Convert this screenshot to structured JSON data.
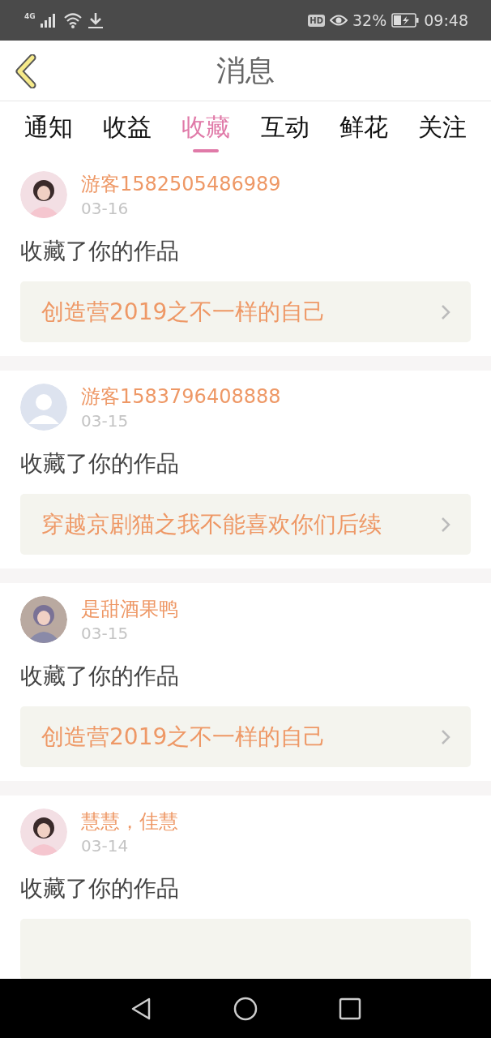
{
  "status_bar": {
    "network": "4G",
    "hd": "HD",
    "battery": "32%",
    "time": "09:48"
  },
  "header": {
    "title": "消息"
  },
  "tabs": [
    {
      "label": "通知",
      "selected": false
    },
    {
      "label": "收益",
      "selected": false
    },
    {
      "label": "收藏",
      "selected": true
    },
    {
      "label": "互动",
      "selected": false
    },
    {
      "label": "鲜花",
      "selected": false
    },
    {
      "label": "关注",
      "selected": false
    }
  ],
  "messages": [
    {
      "kind": "picture",
      "user": "游客1582505486989",
      "date": "03-16",
      "action": "收藏了你的作品",
      "work": "创造营2019之不一样的自己"
    },
    {
      "kind": "default",
      "user": "游客1583796408888",
      "date": "03-15",
      "action": "收藏了你的作品",
      "work": "穿越京剧猫之我不能喜欢你们后续"
    },
    {
      "kind": "picture",
      "user": "是甜酒果鸭",
      "date": "03-15",
      "action": "收藏了你的作品",
      "work": "创造营2019之不一样的自己"
    },
    {
      "kind": "picture",
      "user": "慧慧，佳慧",
      "date": "03-14",
      "action": "收藏了你的作品"
    }
  ]
}
